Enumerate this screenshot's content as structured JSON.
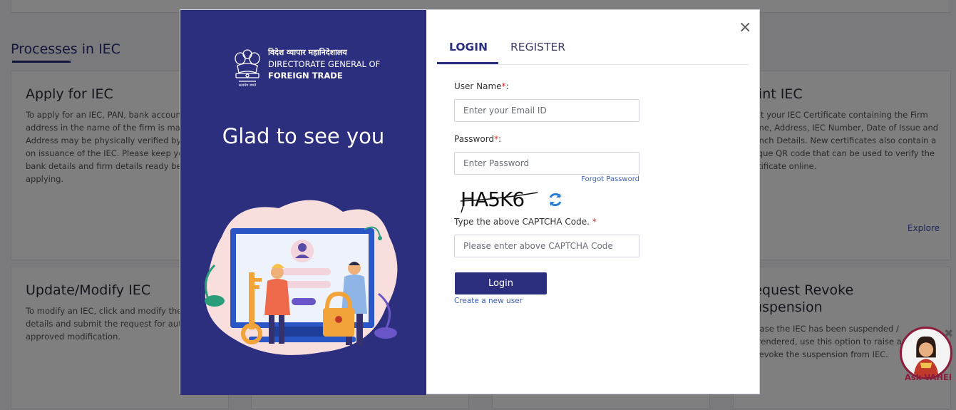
{
  "background": {
    "section_title": "Processes in IEC",
    "cards": [
      {
        "title": "Apply for IEC",
        "text": "To apply for an IEC, PAN, bank account\naddress in the name of the firm is man\nAddress may be physically verified by t\non issuance of the IEC. Please keep you\nbank details and firm details ready befo\napplying."
      },
      {
        "title": "Print IEC",
        "text": "Print your IEC Certificate containing the Firm\nName, Address, IEC Number, Date of Issue and\nBranch Details. New certificates also contain a\nunique QR code that can be used to verify the\ncertificate online."
      },
      {
        "title": "Update/Modify IEC",
        "text": "To modify an IEC, click and modify the I\ndetails and submit the request for auto\napproved modification."
      },
      {
        "title": "Request Revoke\nSuspension",
        "text": "In case the IEC has been suspended /\nsurrendered, use this option to raise a r\nto revoke the suspension from IEC."
      }
    ],
    "explore_label": "Explore"
  },
  "modal": {
    "brand": {
      "hindi": "विदेश व्यापार महानिदेशालय",
      "line2": "DIRECTORATE GENERAL OF",
      "line3": "FOREIGN TRADE"
    },
    "greeting": "Glad to see you",
    "close_symbol": "×",
    "tabs": [
      {
        "label": "LOGIN",
        "active": true
      },
      {
        "label": "REGISTER",
        "active": false
      }
    ],
    "form": {
      "username_label": "User Name",
      "username_placeholder": "Enter your Email ID",
      "password_label": "Password",
      "password_placeholder": "Enter Password",
      "forgot_label": "Forgot Password",
      "captcha_text": "HA5K6",
      "captcha_label": "Type the above CAPTCHA Code.",
      "captcha_placeholder": "Please enter above CAPTCHA Code",
      "required_mark": "*",
      "login_button": "Login",
      "create_link": "Create a new user"
    }
  },
  "chatbot": {
    "label": "Ask VAHEI",
    "close_symbol": "✖"
  },
  "colors": {
    "brand_navy": "#2c2f7e",
    "link_blue": "#3c5fb5",
    "required_red": "#d32f2f"
  }
}
